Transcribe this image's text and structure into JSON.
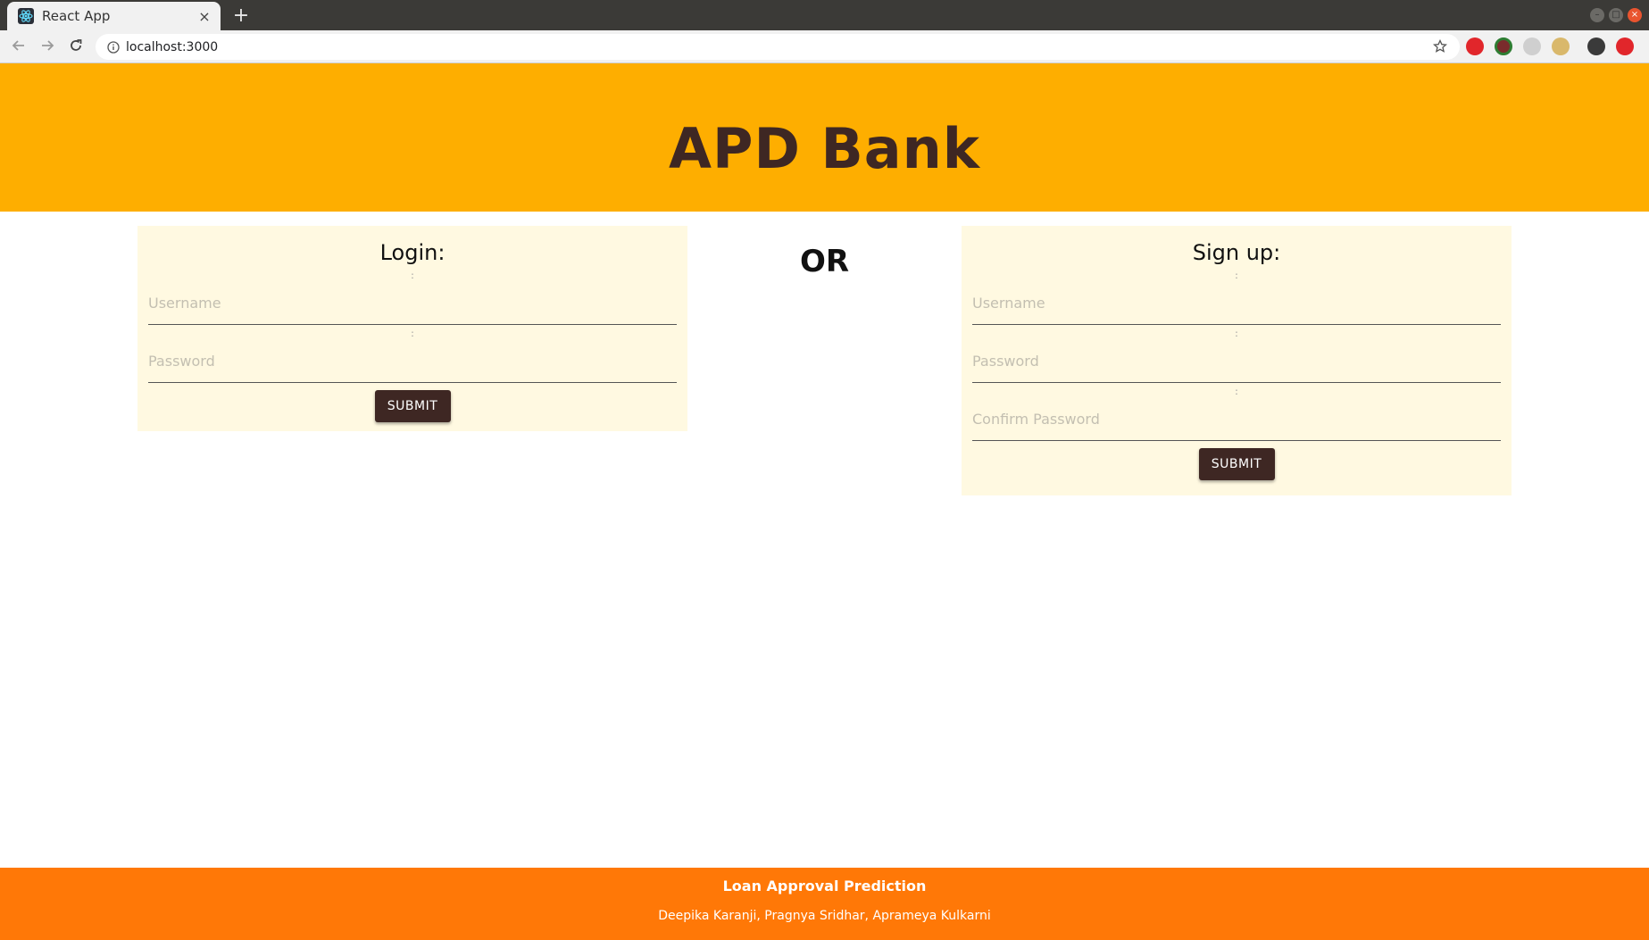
{
  "browser": {
    "tab_title": "React App",
    "tab_close": "×",
    "new_tab": "+",
    "url": "localhost:3000",
    "window_buttons": [
      "–",
      "□",
      "×"
    ]
  },
  "header": {
    "brand": "APD Bank"
  },
  "login": {
    "title": "Login:",
    "username_label": ":",
    "username_placeholder": "Username",
    "password_label": ":",
    "password_placeholder": "Password",
    "submit_label": "SUBMIT"
  },
  "separator": {
    "text": "OR"
  },
  "signup": {
    "title": "Sign up:",
    "username_label": ":",
    "username_placeholder": "Username",
    "password_label": ":",
    "password_placeholder": "Password",
    "confirm_label": ":",
    "confirm_placeholder": "Confirm Password",
    "submit_label": "SUBMIT"
  },
  "footer": {
    "title": "Loan Approval Prediction",
    "authors": "Deepika Karanji, Pragnya Sridhar, Aprameya Kulkarni"
  },
  "colors": {
    "header_bg": "#feae00",
    "brand_text": "#3e2723",
    "card_bg": "#fff9e1",
    "button_bg": "#3e2723",
    "footer_bg": "#ff7807"
  }
}
